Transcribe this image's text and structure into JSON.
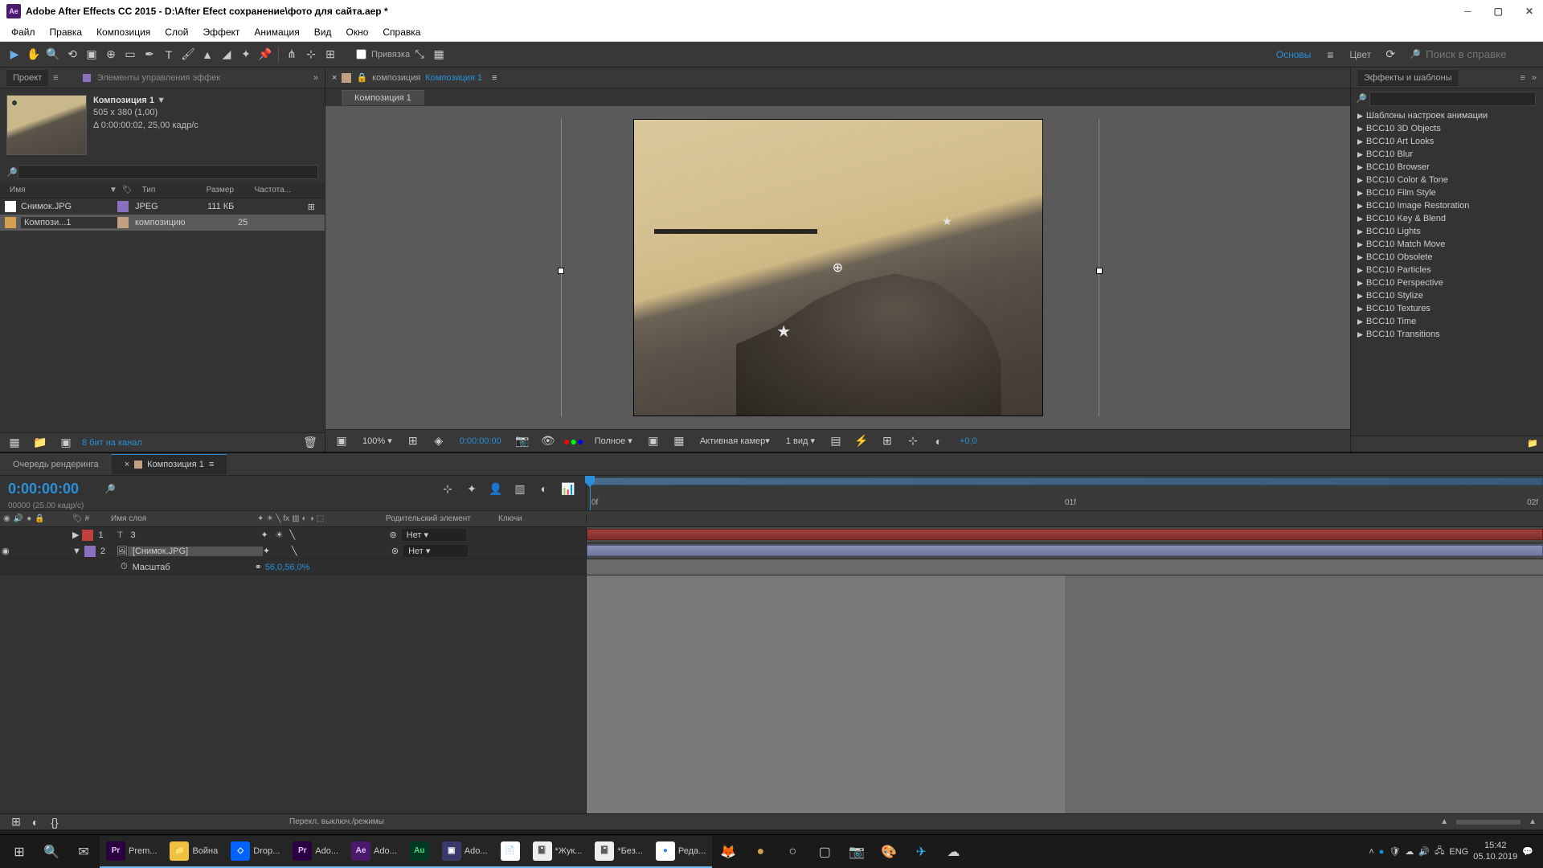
{
  "titlebar": {
    "app_icon": "Ae",
    "title": "Adobe After Effects CC 2015 - D:\\After Efect сохранение\\фото для сайта.aep *"
  },
  "menu": [
    "Файл",
    "Правка",
    "Композиция",
    "Слой",
    "Эффект",
    "Анимация",
    "Вид",
    "Окно",
    "Справка"
  ],
  "toolbar": {
    "snap_label": "Привязка",
    "basics_link": "Основы",
    "color_label": "Цвет",
    "search_placeholder": "Поиск в справке"
  },
  "project": {
    "panel_title": "Проект",
    "controls_title": "Элементы управления эффек",
    "comp_name": "Композиция 1",
    "comp_dims": "505 x 380 (1,00)",
    "comp_duration": "Δ 0:00:00:02, 25,00 кадр/с",
    "cols": {
      "name": "Имя",
      "type": "Тип",
      "size": "Размер",
      "freq": "Частота..."
    },
    "items": [
      {
        "name": "Снимок.JPG",
        "type": "JPEG",
        "size": "111 КБ",
        "selected": false
      },
      {
        "name": "Компози...1",
        "type": "композицию",
        "size": "25",
        "selected": true
      }
    ],
    "bpc": "8 бит на канал"
  },
  "composition": {
    "label": "композиция",
    "active": "Композиция 1",
    "tab": "Композиция 1",
    "zoom": "100%",
    "timecode": "0:00:00:00",
    "resolution": "Полное",
    "camera": "Активная камер",
    "views": "1 вид",
    "exposure": "+0,0"
  },
  "effects": {
    "panel_title": "Эффекты и шаблоны",
    "items": [
      "Шаблоны настроек анимации",
      "BCC10 3D Objects",
      "BCC10 Art Looks",
      "BCC10 Blur",
      "BCC10 Browser",
      "BCC10 Color & Tone",
      "BCC10 Film Style",
      "BCC10 Image Restoration",
      "BCC10 Key & Blend",
      "BCC10 Lights",
      "BCC10 Match Move",
      "BCC10 Obsolete",
      "BCC10 Particles",
      "BCC10 Perspective",
      "BCC10 Stylize",
      "BCC10 Textures",
      "BCC10 Time",
      "BCC10 Transitions"
    ]
  },
  "timeline": {
    "render_queue": "Очередь рендеринга",
    "comp_tab": "Композиция 1",
    "timecode": "0:00:00:00",
    "frame_info": "00000 (25.00 кадр/с)",
    "col_layer": "Имя слоя",
    "col_parent": "Родительский элемент",
    "col_keys": "Ключи",
    "ruler_marks": [
      "0f",
      "01f",
      "02f"
    ],
    "layers": [
      {
        "num": "1",
        "name": "3",
        "parent": "Нет"
      },
      {
        "num": "2",
        "name": "[Снимок.JPG]",
        "parent": "Нет"
      }
    ],
    "scale_label": "Масштаб",
    "scale_value": "56,0,56,0%",
    "footer": "Перекл. выключ./режимы"
  },
  "taskbar": {
    "apps": [
      {
        "icon": "Pr",
        "bg": "#2a0040",
        "fg": "#e6c3ff",
        "label": "Prem..."
      },
      {
        "icon": "📁",
        "bg": "#f0c040",
        "fg": "#000",
        "label": "Война"
      },
      {
        "icon": "◇",
        "bg": "#0062ff",
        "fg": "#fff",
        "label": "Drop..."
      },
      {
        "icon": "Pr",
        "bg": "#2a0040",
        "fg": "#e6c3ff",
        "label": "Ado..."
      },
      {
        "icon": "Ae",
        "bg": "#4a1a6b",
        "fg": "#e6c3ff",
        "label": "Ado..."
      },
      {
        "icon": "Au",
        "bg": "#003822",
        "fg": "#4fd980",
        "label": ""
      },
      {
        "icon": "▣",
        "bg": "#3a3a6a",
        "fg": "#fff",
        "label": "Ado..."
      },
      {
        "icon": "📄",
        "bg": "#fff",
        "fg": "#666",
        "label": ""
      },
      {
        "icon": "📓",
        "bg": "#eee",
        "fg": "#555",
        "label": "*Жук..."
      },
      {
        "icon": "📓",
        "bg": "#eee",
        "fg": "#555",
        "label": "*Без..."
      },
      {
        "icon": "●",
        "bg": "#fff",
        "fg": "#4285f4",
        "label": "Реда..."
      }
    ],
    "lang": "ENG",
    "time": "15:42",
    "date": "05.10.2019"
  }
}
